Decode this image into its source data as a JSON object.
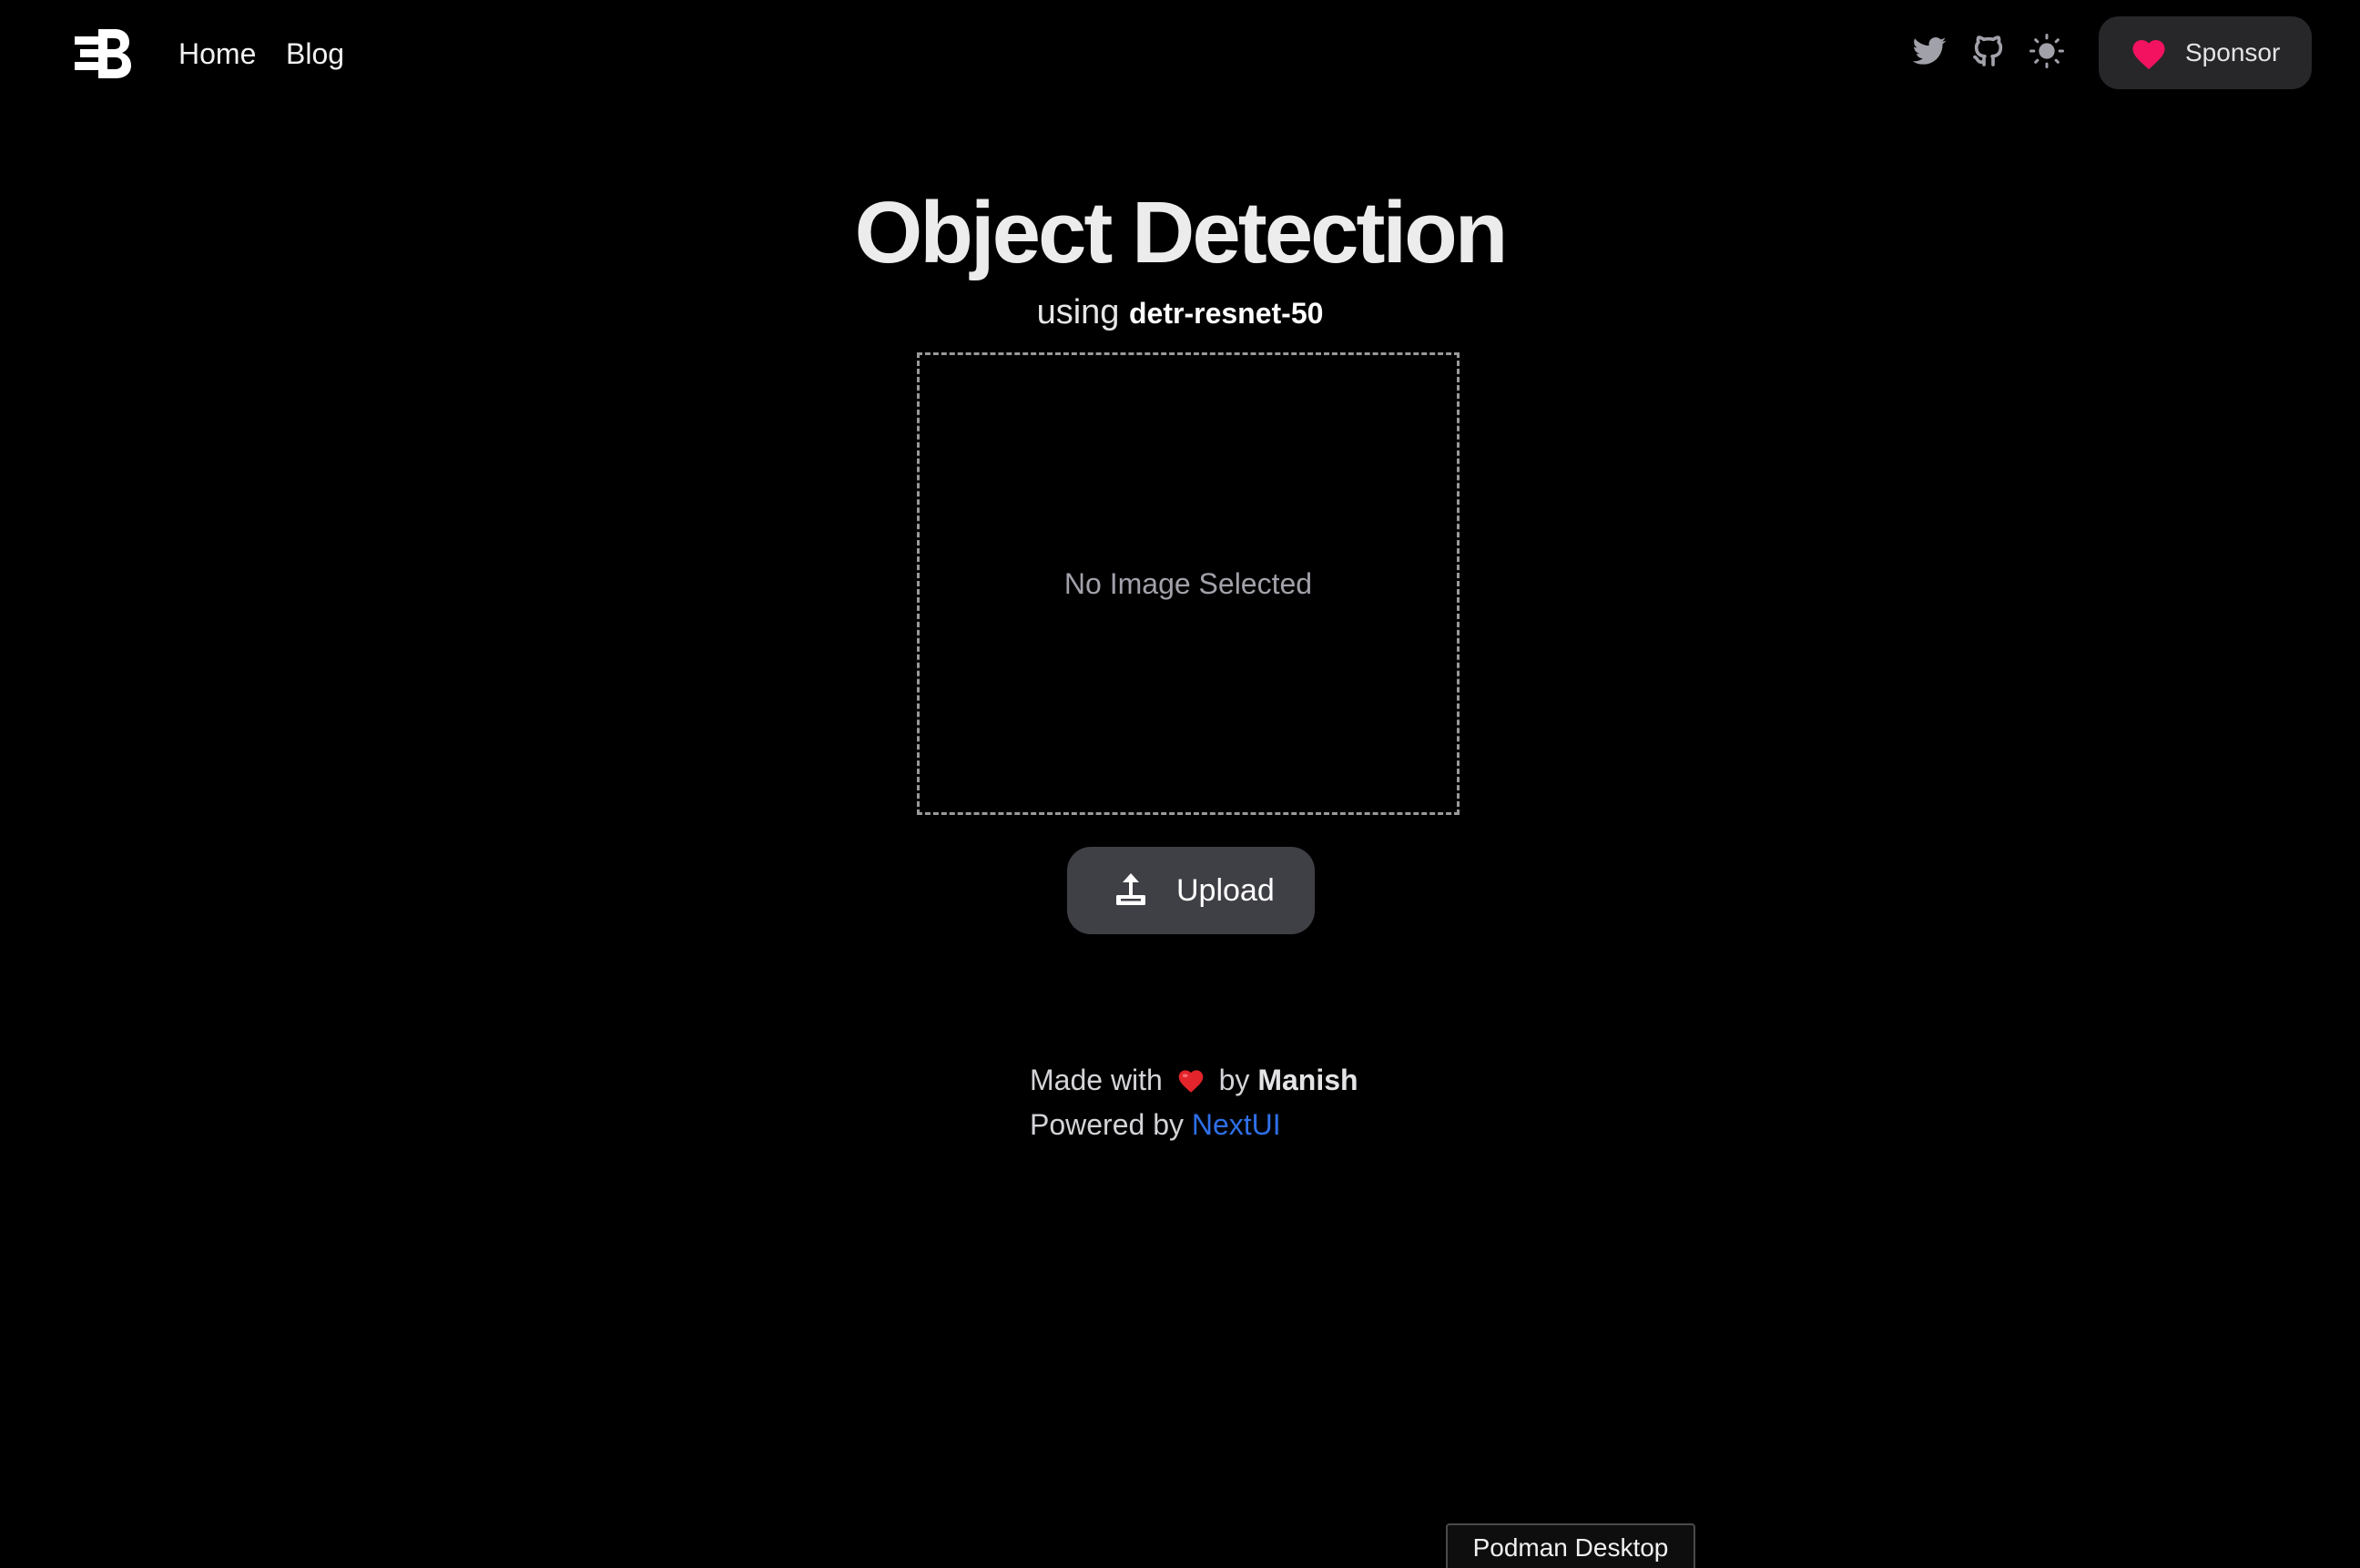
{
  "navbar": {
    "logo_icon": "brand-logo-icon",
    "links": [
      {
        "label": "Home"
      },
      {
        "label": "Blog"
      }
    ],
    "icons": {
      "twitter": "twitter-icon",
      "github": "github-icon",
      "theme": "sun-icon"
    },
    "sponsor_label": "Sponsor"
  },
  "main": {
    "title": "Object Detection",
    "subtitle_prefix": "using",
    "model_name": "detr-resnet-50",
    "dropzone_empty_text": "No Image Selected",
    "upload_label": "Upload"
  },
  "footer": {
    "made_with": "Made with",
    "by": "by",
    "author": "Manish",
    "powered_by": "Powered by",
    "powered_link": "NextUI"
  },
  "tooltip": {
    "text": "Podman Desktop"
  },
  "colors": {
    "background": "#000000",
    "accent_heart": "#f31260",
    "link_blue": "#2f6fe8",
    "button_bg": "#3f3f46",
    "sponsor_bg": "#27272a"
  }
}
